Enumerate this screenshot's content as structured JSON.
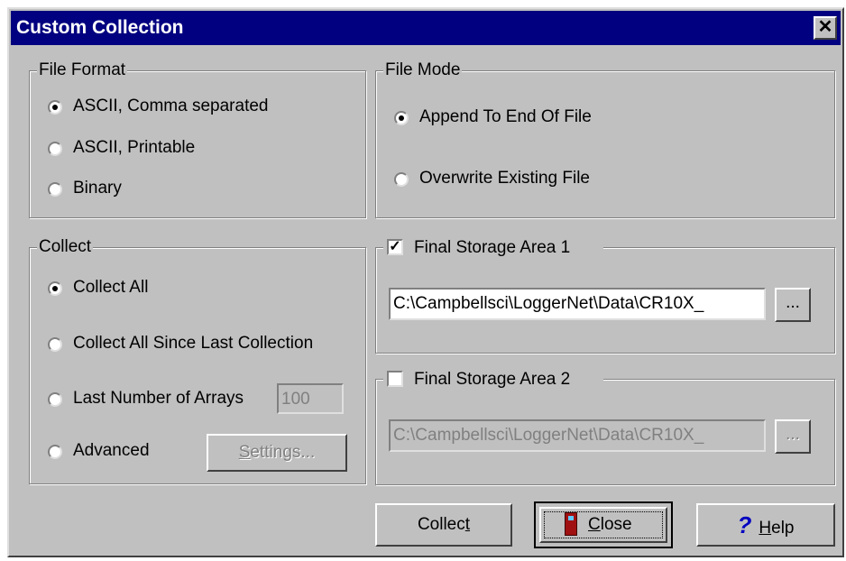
{
  "window": {
    "title": "Custom Collection",
    "close_glyph": "✕"
  },
  "file_format": {
    "legend": "File Format",
    "options": [
      {
        "label": "ASCII, Comma separated",
        "selected": true
      },
      {
        "label": "ASCII, Printable",
        "selected": false
      },
      {
        "label": "Binary",
        "selected": false
      }
    ]
  },
  "file_mode": {
    "legend": "File Mode",
    "options": [
      {
        "label": "Append To End Of File",
        "selected": true
      },
      {
        "label": "Overwrite Existing File",
        "selected": false
      }
    ]
  },
  "collect": {
    "legend": "Collect",
    "options": [
      {
        "label": "Collect All",
        "selected": true
      },
      {
        "label": "Collect All Since Last Collection",
        "selected": false
      },
      {
        "label": "Last Number of Arrays",
        "selected": false
      },
      {
        "label": "Advanced",
        "selected": false
      }
    ],
    "arrays_value": "100",
    "settings_label_u": "S",
    "settings_label_rest": "ettings..."
  },
  "storage1": {
    "label": "Final Storage Area 1",
    "checked": true,
    "path": "C:\\Campbellsci\\LoggerNet\\Data\\CR10X_",
    "browse_label": "..."
  },
  "storage2": {
    "label": "Final Storage Area 2",
    "checked": false,
    "path": "C:\\Campbellsci\\LoggerNet\\Data\\CR10X_",
    "browse_label": "..."
  },
  "buttons": {
    "collect_pre": "Collec",
    "collect_u": "t",
    "close_u": "C",
    "close_rest": "lose",
    "help_icon": "?",
    "help_u": "H",
    "help_rest": "elp"
  }
}
